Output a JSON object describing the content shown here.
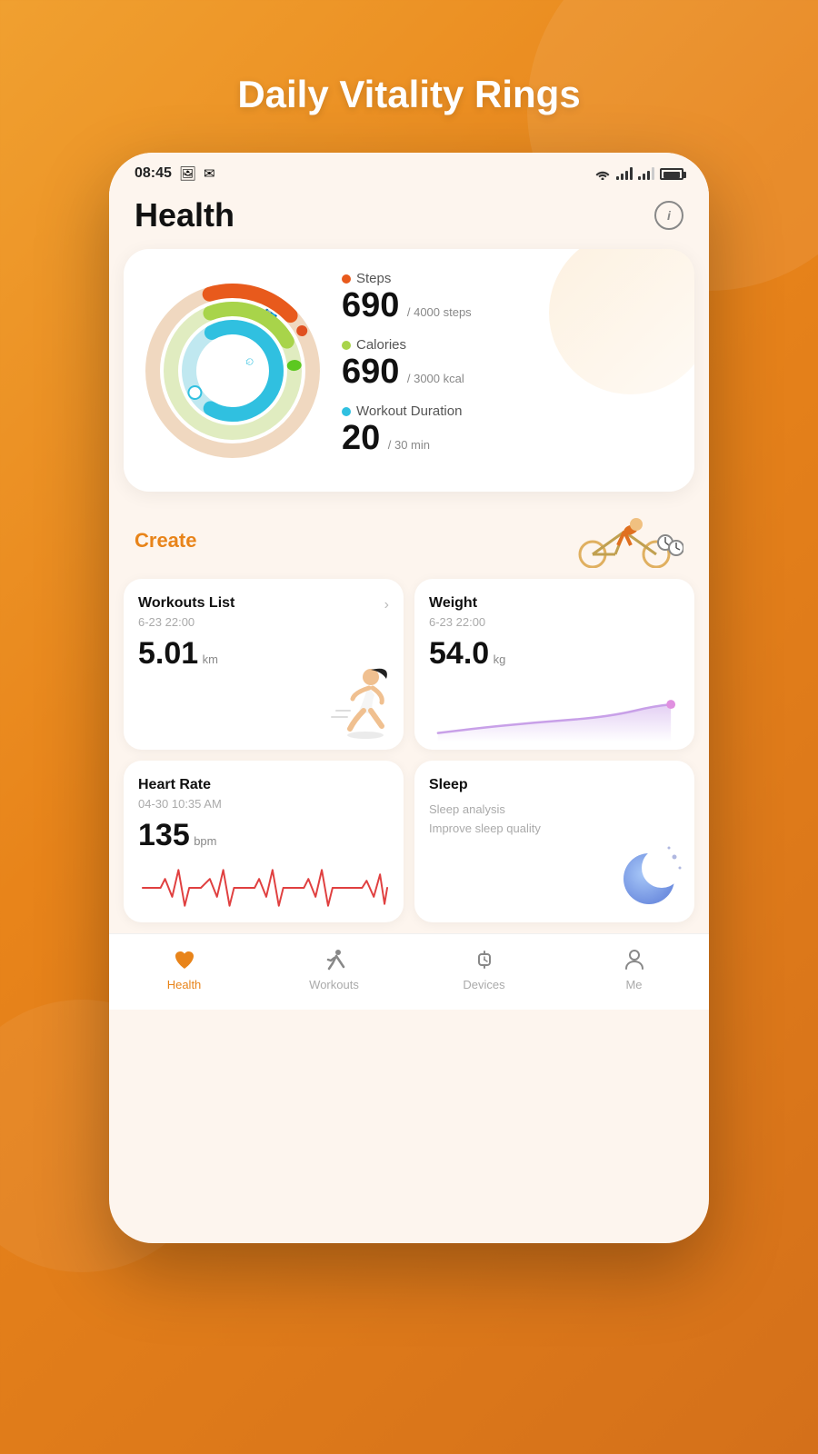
{
  "page": {
    "title": "Daily Vitality Rings",
    "background_color": "#e8841a"
  },
  "status_bar": {
    "time": "08:45",
    "wifi": true,
    "signal1": "full",
    "signal2": "partial",
    "battery": "full"
  },
  "header": {
    "title": "Health",
    "info_label": "i"
  },
  "rings": {
    "steps": {
      "label": "Steps",
      "value": "690",
      "unit": "/ 4000 steps",
      "color": "#e85a1c",
      "dot_color": "#e85a1c"
    },
    "calories": {
      "label": "Calories",
      "value": "690",
      "unit": "/ 3000 kcal",
      "color": "#a8d44a",
      "dot_color": "#a8d44a"
    },
    "workout": {
      "label": "Workout Duration",
      "value": "20",
      "unit": "/ 30 min",
      "color": "#30c0e0",
      "dot_color": "#30c0e0"
    }
  },
  "create_section": {
    "label": "Create"
  },
  "workouts_card": {
    "title": "Workouts List",
    "has_chevron": true,
    "chevron": "›",
    "date": "6-23  22:00",
    "value": "5.01",
    "unit": "km"
  },
  "weight_card": {
    "title": "Weight",
    "date": "6-23  22:00",
    "value": "54.0",
    "unit": "kg"
  },
  "heart_rate_card": {
    "title": "Heart Rate",
    "date": "04-30  10:35 AM",
    "value": "135",
    "unit": "bpm"
  },
  "sleep_card": {
    "title": "Sleep",
    "subtitle1": "Sleep analysis",
    "subtitle2": "Improve sleep quality"
  },
  "bottom_nav": {
    "items": [
      {
        "id": "health",
        "label": "Health",
        "active": true
      },
      {
        "id": "workouts",
        "label": "Workouts",
        "active": false
      },
      {
        "id": "devices",
        "label": "Devices",
        "active": false
      },
      {
        "id": "me",
        "label": "Me",
        "active": false
      }
    ]
  }
}
